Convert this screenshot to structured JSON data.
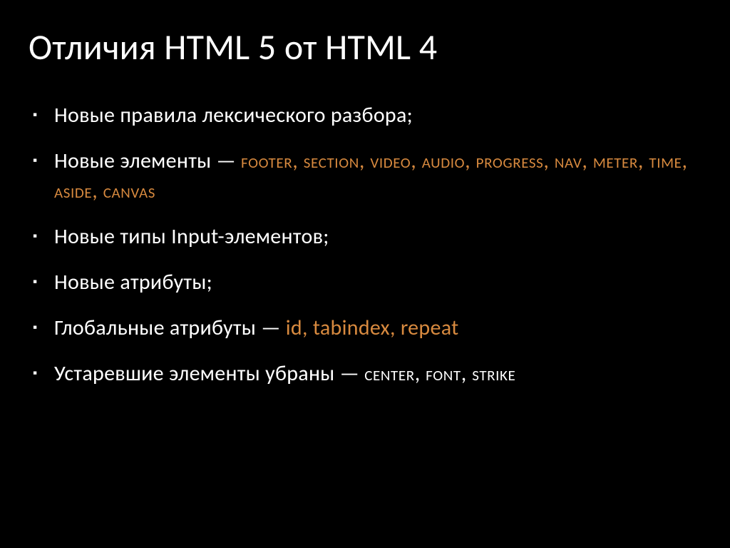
{
  "colors": {
    "background": "#000000",
    "text": "#ffffff",
    "accent": "#d88a3f"
  },
  "title": "Отличия HTML 5 от HTML 4",
  "bullets": {
    "b0": {
      "plain0": "Новые правила лексического разбора;"
    },
    "b1": {
      "plain0": "Новые элементы — ",
      "accent0": "Footer, Section, Video, Audio, Progress, Nav, Meter, Time, Aside, Canvas"
    },
    "b2": {
      "plain0": "Новые типы Input-элементов;"
    },
    "b3": {
      "plain0": "Новые атрибуты;"
    },
    "b4": {
      "plain0": "Глобальные атрибуты — ",
      "accent0": "id, tabindex, repeat"
    },
    "b5": {
      "plain0": "Устаревшие элементы убраны — ",
      "plain1": "Center, Font, Strike"
    }
  }
}
